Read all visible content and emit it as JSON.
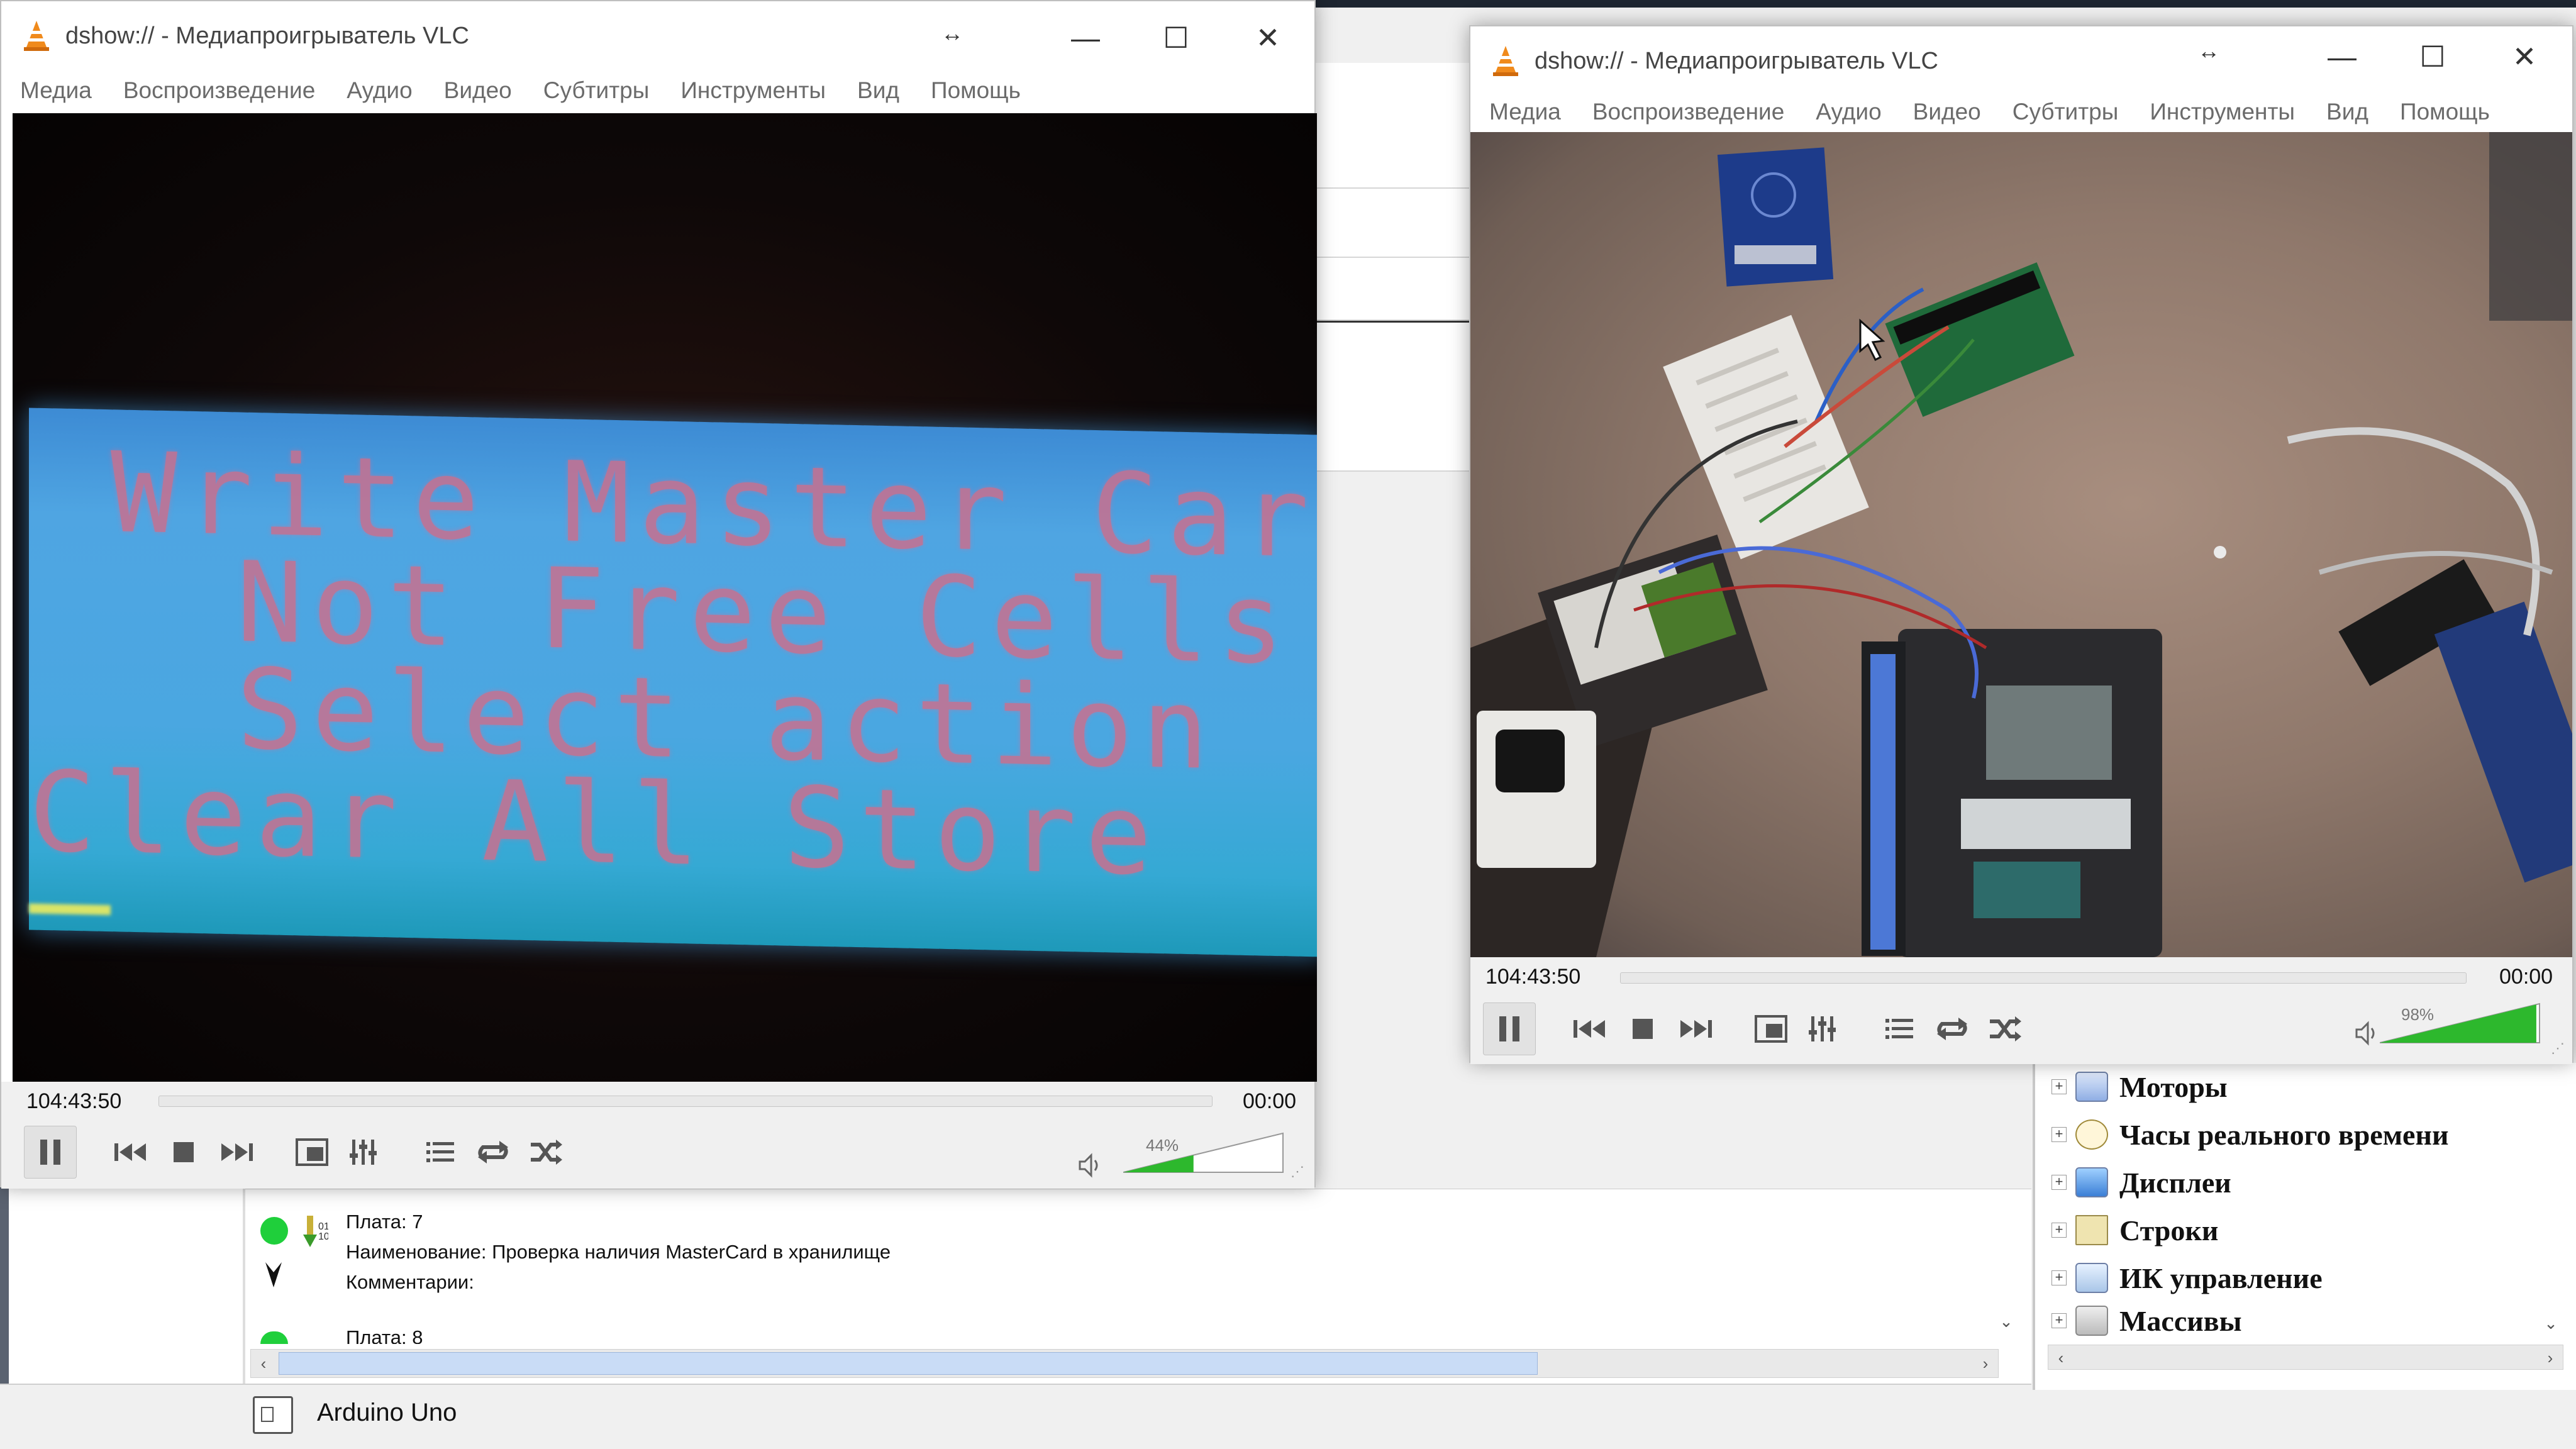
{
  "left_window": {
    "title": "dshow:// - Медиапроигрыватель VLC",
    "menu": [
      "Медиа",
      "Воспроизведение",
      "Аудио",
      "Видео",
      "Субтитры",
      "Инструменты",
      "Вид",
      "Помощь"
    ],
    "lcd_lines": [
      "Write Master Card",
      "Not Free Cells",
      "Select action",
      "Clear All Store"
    ],
    "time_elapsed": "104:43:50",
    "time_total": "00:00",
    "volume_label": "44%",
    "volume_fraction": 0.44
  },
  "right_window": {
    "title": "dshow:// - Медиапроигрыватель VLC",
    "menu": [
      "Медиа",
      "Воспроизведение",
      "Аудио",
      "Видео",
      "Субтитры",
      "Инструменты",
      "Вид",
      "Помощь"
    ],
    "time_elapsed": "104:43:50",
    "time_total": "00:00",
    "volume_label": "98%",
    "volume_fraction": 0.98
  },
  "program": {
    "plate_label": "Плата: 7",
    "name_label": "Наименование: Проверка наличия MasterCard в хранилище",
    "comment_label": "Комментарии:",
    "next_plate_label": "Плата: 8"
  },
  "status": {
    "board": "Arduino Uno"
  },
  "tree": {
    "items": [
      "Моторы",
      "Часы реального времени",
      "Дисплеи",
      "Строки",
      "ИК управление",
      "Массивы"
    ]
  },
  "colors": {
    "status_dot": "#1fcf3b",
    "volume_green": "#2db82d",
    "vlc_orange": "#f08a1c"
  }
}
